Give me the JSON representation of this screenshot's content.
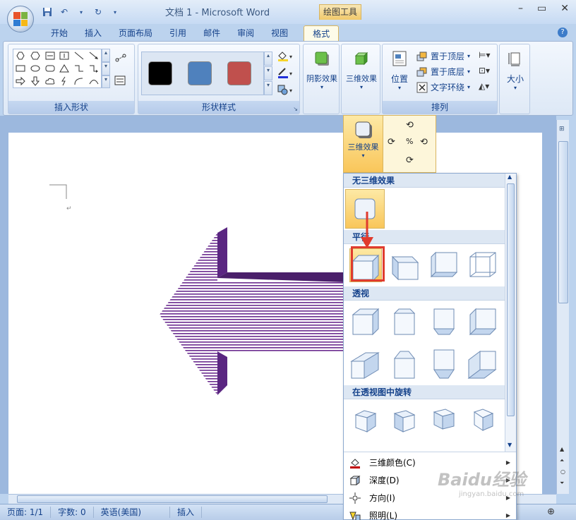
{
  "window": {
    "title": "文档 1 - Microsoft Word",
    "context_tab_header": "绘图工具"
  },
  "tabs": [
    "开始",
    "插入",
    "页面布局",
    "引用",
    "邮件",
    "审阅",
    "视图",
    "格式"
  ],
  "ribbon": {
    "insert_shapes_label": "插入形状",
    "shape_styles_label": "形状样式",
    "shadow_effects_label": "阴影效果",
    "three_d_effects_label": "三维效果",
    "position_label": "位置",
    "bring_to_front_label": "置于顶层",
    "send_to_back_label": "置于底层",
    "text_wrap_label": "文字环绕",
    "arrange_label": "排列",
    "size_label": "大小",
    "swatch_colors": [
      "#000000",
      "#4f81bd",
      "#c0504d"
    ]
  },
  "three_d_button": {
    "label": "三维效果"
  },
  "dropdown": {
    "sections": {
      "none": "无三维效果",
      "parallel": "平行",
      "perspective": "透视",
      "rotation": "在透视图中旋转"
    },
    "menu": {
      "color": "三维颜色(C)",
      "depth": "深度(D)",
      "direction": "方向(I)",
      "lighting": "照明(L)"
    }
  },
  "statusbar": {
    "page": "页面: 1/1",
    "words": "字数: 0",
    "language": "英语(美国)",
    "mode": "插入"
  },
  "watermark": {
    "brand": "Baidu经验",
    "url": "jingyan.baidu.com"
  }
}
